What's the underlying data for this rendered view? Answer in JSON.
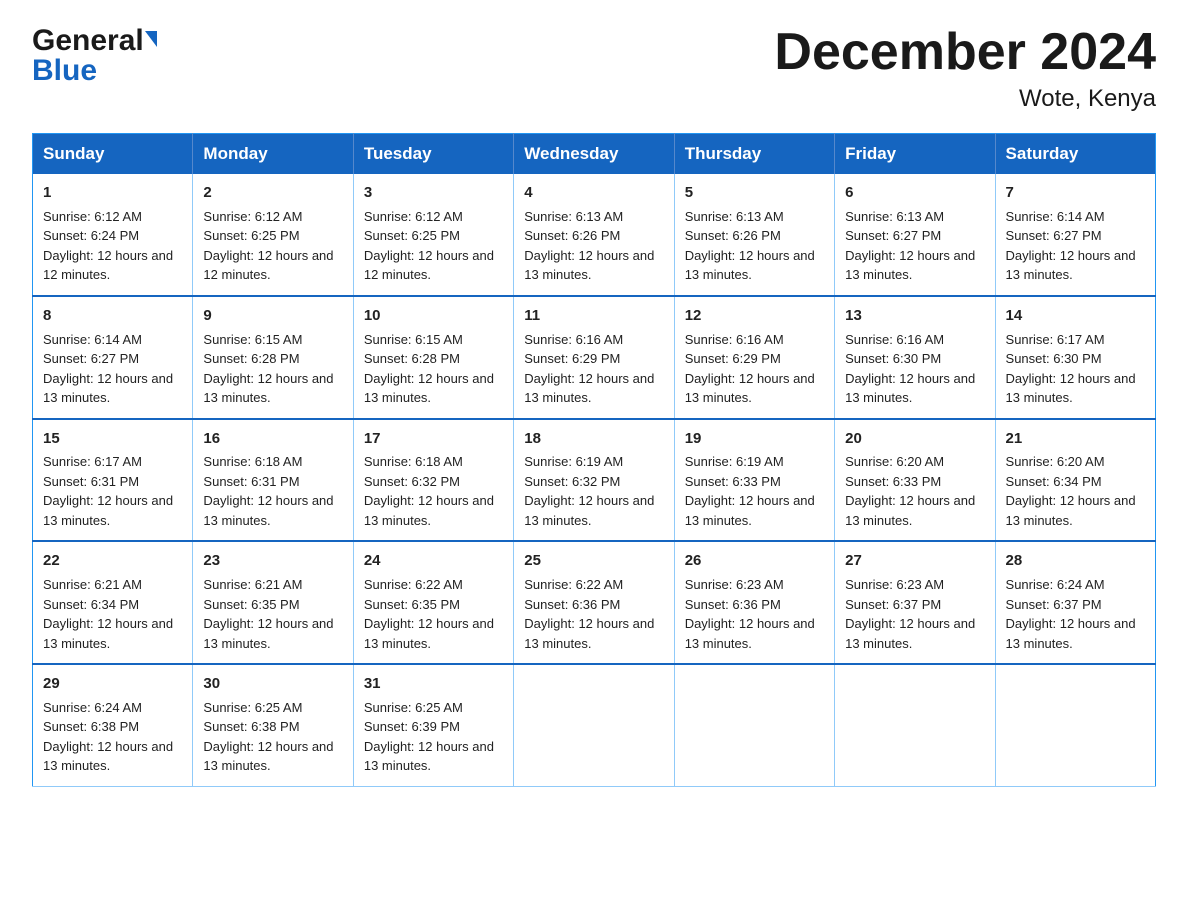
{
  "header": {
    "logo_line1": "General",
    "logo_line2": "Blue",
    "month_title": "December 2024",
    "location": "Wote, Kenya"
  },
  "calendar": {
    "days_of_week": [
      "Sunday",
      "Monday",
      "Tuesday",
      "Wednesday",
      "Thursday",
      "Friday",
      "Saturday"
    ],
    "weeks": [
      [
        {
          "date": "1",
          "sunrise": "6:12 AM",
          "sunset": "6:24 PM",
          "daylight": "12 hours and 12 minutes."
        },
        {
          "date": "2",
          "sunrise": "6:12 AM",
          "sunset": "6:25 PM",
          "daylight": "12 hours and 12 minutes."
        },
        {
          "date": "3",
          "sunrise": "6:12 AM",
          "sunset": "6:25 PM",
          "daylight": "12 hours and 12 minutes."
        },
        {
          "date": "4",
          "sunrise": "6:13 AM",
          "sunset": "6:26 PM",
          "daylight": "12 hours and 13 minutes."
        },
        {
          "date": "5",
          "sunrise": "6:13 AM",
          "sunset": "6:26 PM",
          "daylight": "12 hours and 13 minutes."
        },
        {
          "date": "6",
          "sunrise": "6:13 AM",
          "sunset": "6:27 PM",
          "daylight": "12 hours and 13 minutes."
        },
        {
          "date": "7",
          "sunrise": "6:14 AM",
          "sunset": "6:27 PM",
          "daylight": "12 hours and 13 minutes."
        }
      ],
      [
        {
          "date": "8",
          "sunrise": "6:14 AM",
          "sunset": "6:27 PM",
          "daylight": "12 hours and 13 minutes."
        },
        {
          "date": "9",
          "sunrise": "6:15 AM",
          "sunset": "6:28 PM",
          "daylight": "12 hours and 13 minutes."
        },
        {
          "date": "10",
          "sunrise": "6:15 AM",
          "sunset": "6:28 PM",
          "daylight": "12 hours and 13 minutes."
        },
        {
          "date": "11",
          "sunrise": "6:16 AM",
          "sunset": "6:29 PM",
          "daylight": "12 hours and 13 minutes."
        },
        {
          "date": "12",
          "sunrise": "6:16 AM",
          "sunset": "6:29 PM",
          "daylight": "12 hours and 13 minutes."
        },
        {
          "date": "13",
          "sunrise": "6:16 AM",
          "sunset": "6:30 PM",
          "daylight": "12 hours and 13 minutes."
        },
        {
          "date": "14",
          "sunrise": "6:17 AM",
          "sunset": "6:30 PM",
          "daylight": "12 hours and 13 minutes."
        }
      ],
      [
        {
          "date": "15",
          "sunrise": "6:17 AM",
          "sunset": "6:31 PM",
          "daylight": "12 hours and 13 minutes."
        },
        {
          "date": "16",
          "sunrise": "6:18 AM",
          "sunset": "6:31 PM",
          "daylight": "12 hours and 13 minutes."
        },
        {
          "date": "17",
          "sunrise": "6:18 AM",
          "sunset": "6:32 PM",
          "daylight": "12 hours and 13 minutes."
        },
        {
          "date": "18",
          "sunrise": "6:19 AM",
          "sunset": "6:32 PM",
          "daylight": "12 hours and 13 minutes."
        },
        {
          "date": "19",
          "sunrise": "6:19 AM",
          "sunset": "6:33 PM",
          "daylight": "12 hours and 13 minutes."
        },
        {
          "date": "20",
          "sunrise": "6:20 AM",
          "sunset": "6:33 PM",
          "daylight": "12 hours and 13 minutes."
        },
        {
          "date": "21",
          "sunrise": "6:20 AM",
          "sunset": "6:34 PM",
          "daylight": "12 hours and 13 minutes."
        }
      ],
      [
        {
          "date": "22",
          "sunrise": "6:21 AM",
          "sunset": "6:34 PM",
          "daylight": "12 hours and 13 minutes."
        },
        {
          "date": "23",
          "sunrise": "6:21 AM",
          "sunset": "6:35 PM",
          "daylight": "12 hours and 13 minutes."
        },
        {
          "date": "24",
          "sunrise": "6:22 AM",
          "sunset": "6:35 PM",
          "daylight": "12 hours and 13 minutes."
        },
        {
          "date": "25",
          "sunrise": "6:22 AM",
          "sunset": "6:36 PM",
          "daylight": "12 hours and 13 minutes."
        },
        {
          "date": "26",
          "sunrise": "6:23 AM",
          "sunset": "6:36 PM",
          "daylight": "12 hours and 13 minutes."
        },
        {
          "date": "27",
          "sunrise": "6:23 AM",
          "sunset": "6:37 PM",
          "daylight": "12 hours and 13 minutes."
        },
        {
          "date": "28",
          "sunrise": "6:24 AM",
          "sunset": "6:37 PM",
          "daylight": "12 hours and 13 minutes."
        }
      ],
      [
        {
          "date": "29",
          "sunrise": "6:24 AM",
          "sunset": "6:38 PM",
          "daylight": "12 hours and 13 minutes."
        },
        {
          "date": "30",
          "sunrise": "6:25 AM",
          "sunset": "6:38 PM",
          "daylight": "12 hours and 13 minutes."
        },
        {
          "date": "31",
          "sunrise": "6:25 AM",
          "sunset": "6:39 PM",
          "daylight": "12 hours and 13 minutes."
        },
        null,
        null,
        null,
        null
      ]
    ]
  }
}
